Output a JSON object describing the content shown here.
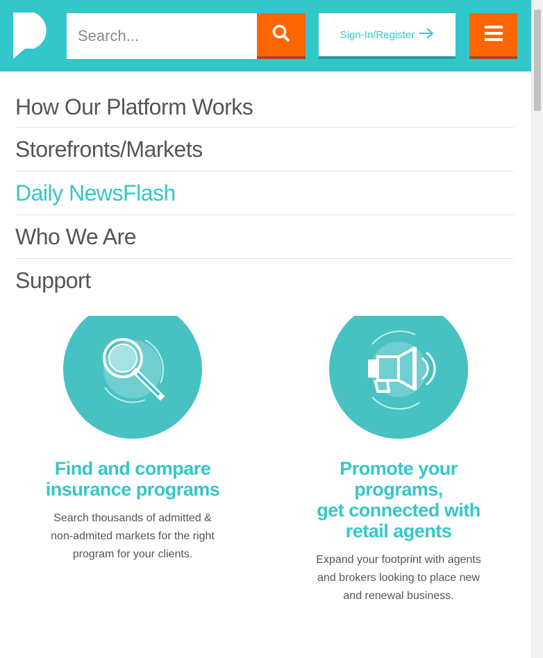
{
  "header": {
    "logo_icon": "p-logo-icon",
    "search": {
      "placeholder": "Search...",
      "value": "",
      "icon": "search-icon"
    },
    "signin": {
      "label": "Sign-In/Register",
      "icon": "arrow-right-icon"
    },
    "menu": {
      "icon": "hamburger-menu-icon"
    }
  },
  "nav": {
    "items": [
      {
        "label": "How Our Platform Works",
        "active": false
      },
      {
        "label": "Storefronts/Markets",
        "active": false
      },
      {
        "label": "Daily NewsFlash",
        "active": true
      },
      {
        "label": "Who We Are",
        "active": false
      },
      {
        "label": "Support",
        "active": false
      }
    ]
  },
  "features": [
    {
      "icon": "magnifying-glass-icon",
      "title_line1": "Find and compare",
      "title_line2": "insurance programs",
      "desc_line1": "Search thousands of admitted &",
      "desc_line2": "non-admited markets for the right",
      "desc_line3": "program for your clients."
    },
    {
      "icon": "megaphone-icon",
      "title_line1": "Promote your programs,",
      "title_line2": "get connected with",
      "title_line3": "retail agents",
      "desc_line1": "Expand your footprint with agents",
      "desc_line2": "and brokers looking to place new",
      "desc_line3": "and renewal business."
    }
  ],
  "colors": {
    "brand_teal": "#34c7c9",
    "circle_teal": "#48c1c3",
    "accent_orange": "#ff6600",
    "text_gray": "#555555"
  }
}
